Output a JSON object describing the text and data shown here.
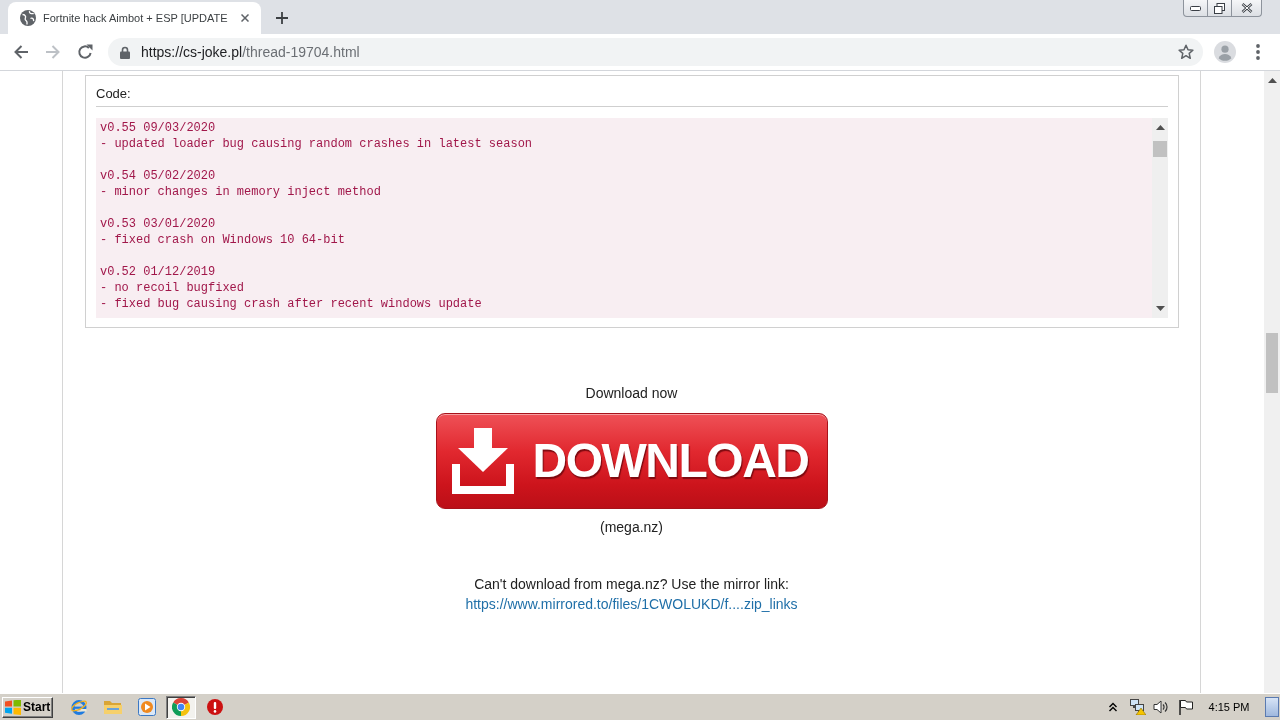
{
  "browser": {
    "tabs": [
      {
        "title": "Fortnite hack Aimbot + ESP [UPDATE",
        "selected": true
      }
    ],
    "nav": [
      {
        "kind": "back",
        "disabled": false
      },
      {
        "kind": "forward",
        "disabled": true
      },
      {
        "kind": "reload",
        "disabled": false
      }
    ],
    "url": {
      "origin": "https://cs-joke.pl",
      "path": "/thread-19704.html"
    }
  },
  "code_box": {
    "label": "Code:",
    "entries": [
      {
        "version": "v0.55 09/03/2020",
        "notes": [
          "- updated loader bug causing random crashes in latest season"
        ]
      },
      {
        "version": "v0.54 05/02/2020",
        "notes": [
          "- minor changes in memory inject method"
        ]
      },
      {
        "version": "v0.53 03/01/2020",
        "notes": [
          "- fixed crash on Windows 10 64-bit"
        ]
      },
      {
        "version": "v0.52 01/12/2019",
        "notes": [
          "- no recoil bugfixed",
          "- fixed bug causing crash after recent windows update"
        ]
      }
    ]
  },
  "download": {
    "heading": "Download now",
    "button": "DOWNLOAD",
    "source": "(mega.nz)",
    "mirror_note": "Can't download from mega.nz? Use the mirror link:",
    "mirror_link": "https://www.mirrored.to/files/1CWOLUKD/f....zip_links"
  },
  "taskbar": {
    "start": "Start",
    "apps": [
      {
        "kind": "ie",
        "selected": false
      },
      {
        "kind": "explorer",
        "selected": false
      },
      {
        "kind": "media",
        "selected": false
      },
      {
        "kind": "chrome",
        "selected": true
      },
      {
        "kind": "stop",
        "selected": false
      }
    ],
    "clock": "4:15 PM"
  }
}
